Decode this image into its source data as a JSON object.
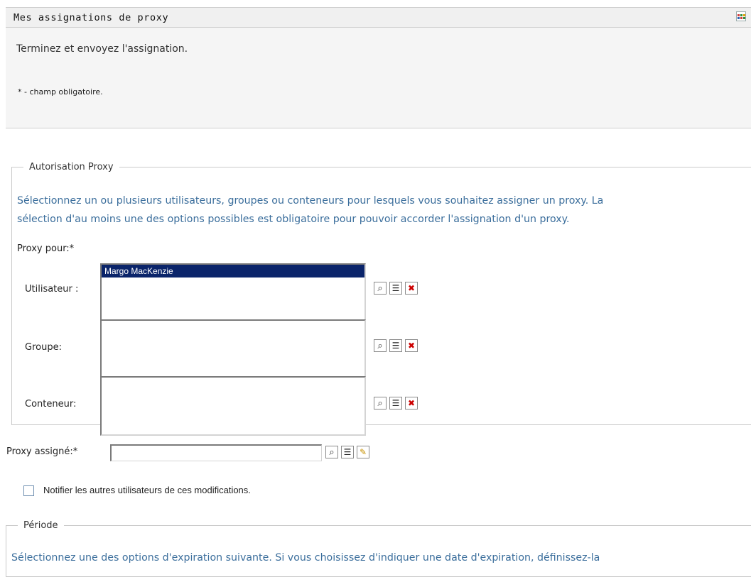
{
  "header": {
    "title": "Mes assignations de proxy",
    "menu_icon": "grid-menu-icon",
    "menu_icon_colors": [
      "#d23a3a",
      "#2e8b3a",
      "#e0a000",
      "#2a5db0"
    ]
  },
  "intro": {
    "instruction": "Terminez et envoyez l'assignation.",
    "required_note": "* - champ obligatoire."
  },
  "authorization": {
    "legend": "Autorisation Proxy",
    "description_line1": "Sélectionnez un ou plusieurs utilisateurs, groupes ou conteneurs pour lesquels vous souhaitez assigner un proxy. La",
    "description_line2": "sélection d'au moins une des options possibles est obligatoire pour pouvoir accorder l'assignation d'un proxy.",
    "proxy_for_label": "Proxy pour:*",
    "user": {
      "label": "Utilisateur :",
      "selected": "Margo MacKenzie"
    },
    "group": {
      "label": "Groupe:"
    },
    "container": {
      "label": "Conteneur:"
    }
  },
  "assigned": {
    "label": "Proxy assigné:*",
    "value": ""
  },
  "notify": {
    "label": "Notifier les autres utilisateurs de ces modifications.",
    "checked": false
  },
  "period": {
    "legend": "Période",
    "description": "Sélectionnez une des options d'expiration suivante. Si vous choisissez d'indiquer une date d'expiration, définissez-la"
  },
  "colors": {
    "instruction_blue": "#3b6e9c",
    "selection_navy": "#0a246a",
    "clear_red": "#cc0000"
  }
}
